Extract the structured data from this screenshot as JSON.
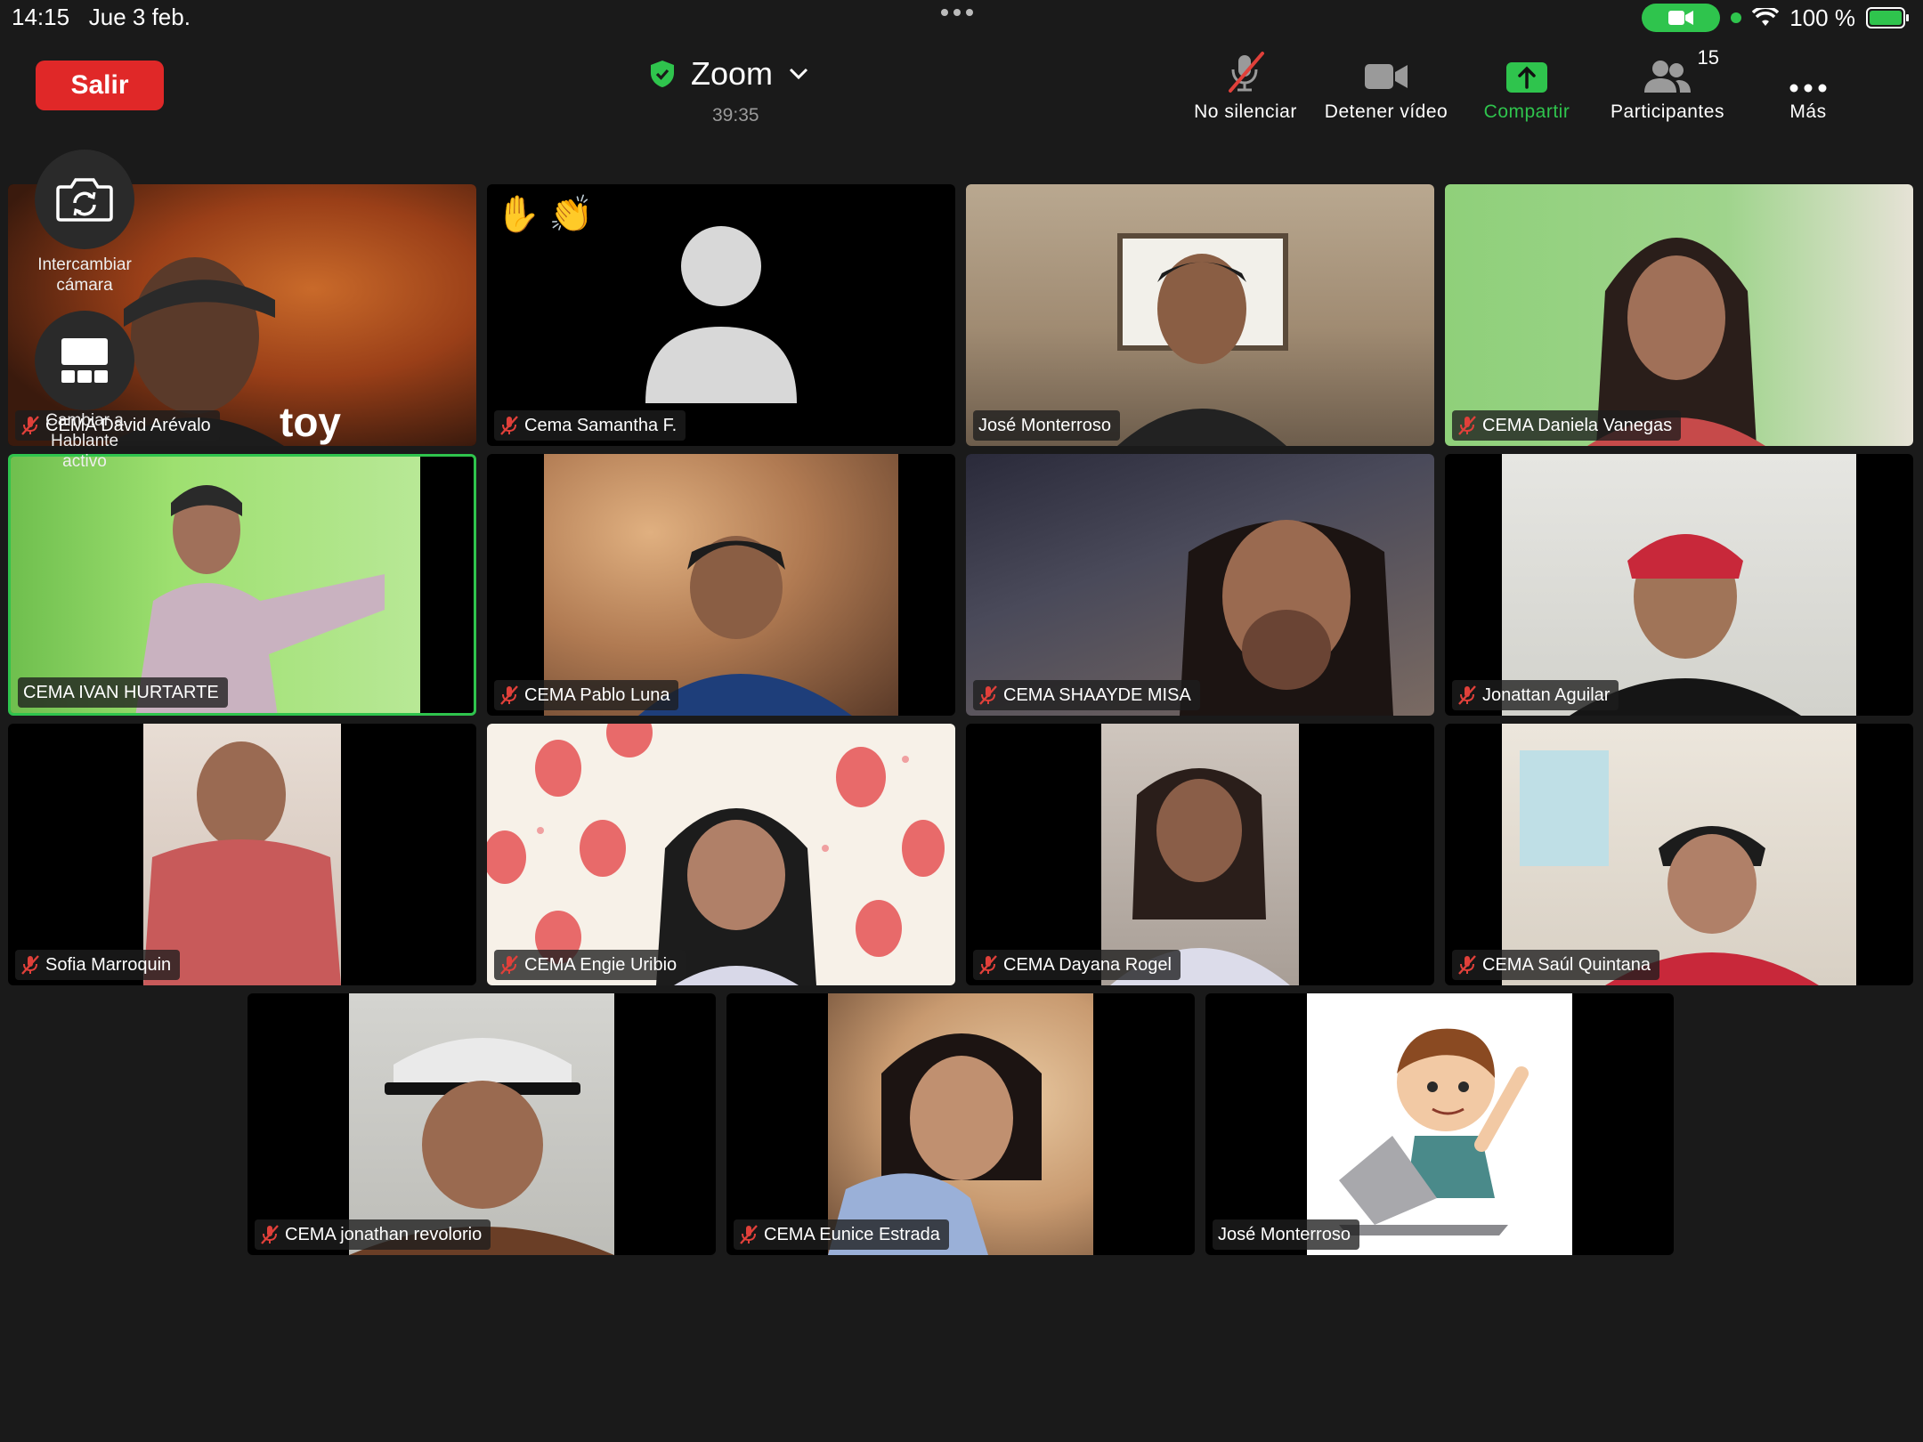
{
  "status_bar": {
    "time": "14:15",
    "date": "Jue 3 feb.",
    "battery": "100 %"
  },
  "header": {
    "leave_label": "Salir",
    "meeting_name": "Zoom",
    "timer": "39:35"
  },
  "toolbar": {
    "mute": "No silenciar",
    "video": "Detener vídeo",
    "share": "Compartir",
    "participants": "Participantes",
    "participants_count": "15",
    "more": "Más"
  },
  "side_controls": {
    "switch_camera": "Intercambiar cámara",
    "active_speaker": "Cambiar a Hablante activo"
  },
  "participants": [
    {
      "name": "CEMA David Arévalo",
      "muted": true
    },
    {
      "name": "Cema Samantha F.",
      "muted": true,
      "reactions": [
        "✋",
        "👏"
      ]
    },
    {
      "name": "José Monterroso",
      "muted": false
    },
    {
      "name": "CEMA Daniela Vanegas",
      "muted": true
    },
    {
      "name": "CEMA IVAN HURTARTE",
      "muted": false,
      "active_speaker": true
    },
    {
      "name": "CEMA Pablo Luna",
      "muted": true
    },
    {
      "name": "CEMA SHAAYDE MISA",
      "muted": true
    },
    {
      "name": "Jonattan Aguilar",
      "muted": true
    },
    {
      "name": "Sofia Marroquin",
      "muted": true
    },
    {
      "name": "CEMA Engie Uribio",
      "muted": true
    },
    {
      "name": "CEMA Dayana Rogel",
      "muted": true
    },
    {
      "name": "CEMA Saúl Quintana",
      "muted": true
    },
    {
      "name": "CEMA jonathan revolorio",
      "muted": true
    },
    {
      "name": "CEMA Eunice Estrada",
      "muted": true
    },
    {
      "name": "José Monterroso",
      "muted": false
    }
  ],
  "tile_overlays": {
    "meme_caption": "toy"
  },
  "colors": {
    "background": "#1a1a1a",
    "leave_red": "#e02828",
    "accent_green": "#2fc44d",
    "mute_red": "#e0403a"
  }
}
